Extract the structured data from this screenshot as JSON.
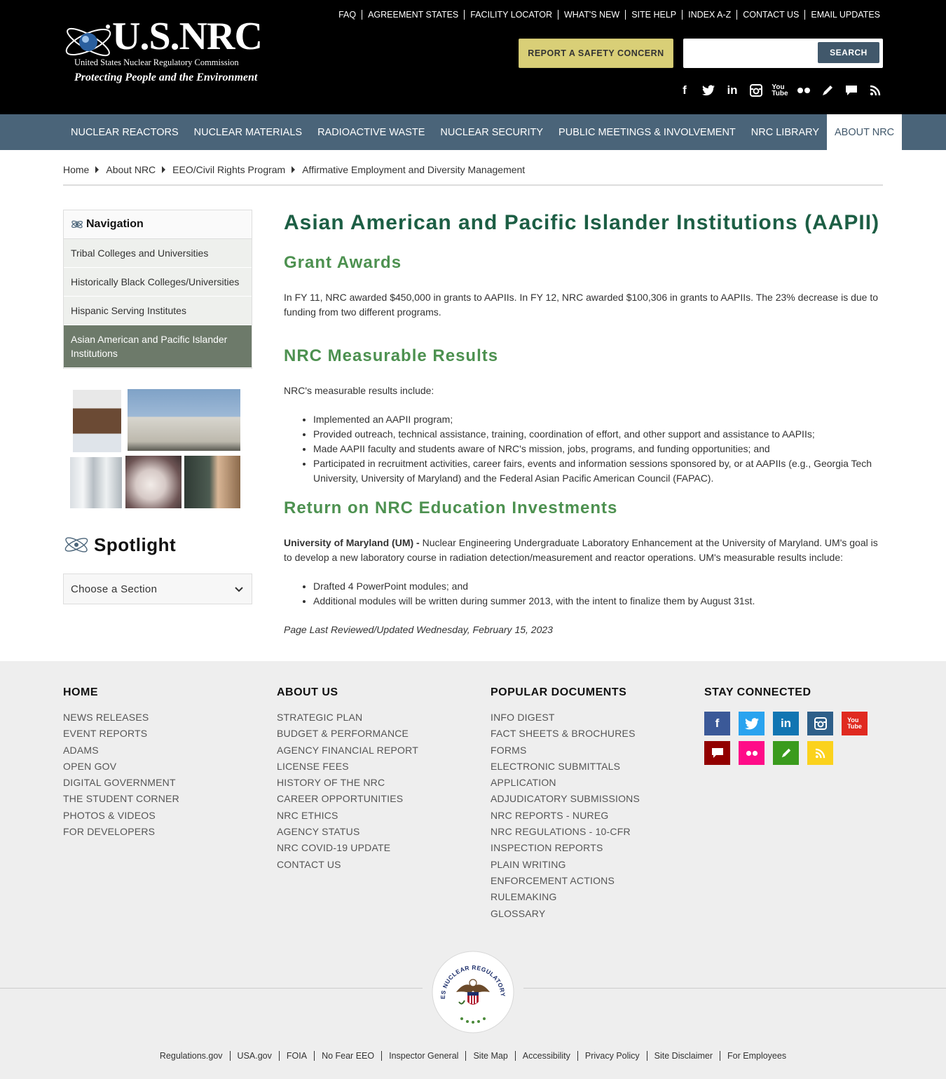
{
  "header": {
    "logo_main": "U.S.NRC",
    "logo_sub1": "United States Nuclear Regulatory Commission",
    "logo_sub2": "Protecting People and the Environment",
    "utility_links": [
      "FAQ",
      "AGREEMENT STATES",
      "FACILITY LOCATOR",
      "WHAT'S NEW",
      "SITE HELP",
      "INDEX A-Z",
      "CONTACT US",
      "EMAIL UPDATES"
    ],
    "report_button": "REPORT A SAFETY CONCERN",
    "search_button": "SEARCH",
    "search_placeholder": "",
    "social_icons": [
      "facebook-icon",
      "twitter-icon",
      "linkedin-icon",
      "instagram-icon",
      "youtube-icon",
      "flickr-icon",
      "blog-icon",
      "comment-icon",
      "rss-icon"
    ]
  },
  "mainnav": {
    "items": [
      "NUCLEAR REACTORS",
      "NUCLEAR MATERIALS",
      "RADIOACTIVE WASTE",
      "NUCLEAR SECURITY",
      "PUBLIC MEETINGS & INVOLVEMENT",
      "NRC LIBRARY",
      "ABOUT NRC"
    ],
    "active": "ABOUT NRC"
  },
  "breadcrumb": [
    "Home",
    "About NRC",
    "EEO/Civil Rights Program",
    "Affirmative Employment and Diversity Management"
  ],
  "sidebar": {
    "nav_title": "Navigation",
    "items": [
      "Tribal Colleges and Universities",
      "Historically Black Colleges/Universities",
      "Hispanic Serving Institutes",
      "Asian American and Pacific Islander Institutions"
    ],
    "active_index": 3,
    "spotlight_title": "Spotlight",
    "choose_section": "Choose a Section"
  },
  "content": {
    "title": "Asian American and Pacific Islander Institutions (AAPII)",
    "grant_heading": "Grant Awards",
    "grant_text": "In FY 11, NRC awarded $450,000 in grants to AAPIIs. In FY 12, NRC awarded $100,306 in grants to AAPIIs. The 23% decrease is due to funding from two different programs.",
    "results_heading": "NRC Measurable Results",
    "results_intro": "NRC's measurable results include:",
    "results_list": [
      "Implemented an AAPII program;",
      "Provided outreach, technical assistance, training, coordination of effort, and other support and assistance to AAPIIs;",
      "Made AAPII faculty and students aware of NRC's mission, jobs, programs, and funding opportunities; and",
      "Participated in recruitment activities, career fairs, events and information sessions sponsored by, or at AAPIIs (e.g., Georgia Tech University, University of Maryland) and the Federal Asian Pacific American Council (FAPAC)."
    ],
    "roi_heading": "Return on NRC Education Investments",
    "roi_bold": "University of Maryland (UM) - ",
    "roi_text": "Nuclear Engineering Undergraduate Laboratory Enhancement at the University of Maryland. UM's goal is to develop a new laboratory course in radiation detection/measurement and reactor operations. UM's measurable results include:",
    "roi_list": [
      "Drafted 4 PowerPoint modules; and",
      "Additional modules will be written during summer 2013, with the intent to finalize them by August 31st."
    ],
    "reviewed": "Page Last Reviewed/Updated Wednesday, February 15, 2023"
  },
  "footer": {
    "col1": {
      "title": "HOME",
      "links": [
        "NEWS RELEASES",
        "EVENT REPORTS",
        "ADAMS",
        "OPEN GOV",
        "DIGITAL GOVERNMENT",
        "THE STUDENT CORNER",
        "PHOTOS & VIDEOS",
        "FOR DEVELOPERS"
      ]
    },
    "col2": {
      "title": "ABOUT US",
      "links": [
        "STRATEGIC PLAN",
        "BUDGET & PERFORMANCE",
        "AGENCY FINANCIAL REPORT",
        "LICENSE FEES",
        "HISTORY OF THE NRC",
        "CAREER OPPORTUNITIES",
        "NRC ETHICS",
        "AGENCY STATUS",
        "NRC COVID-19 UPDATE",
        "CONTACT US"
      ]
    },
    "col3": {
      "title": "POPULAR DOCUMENTS",
      "links": [
        "INFO DIGEST",
        "FACT SHEETS & BROCHURES",
        "FORMS",
        "ELECTRONIC SUBMITTALS",
        "APPLICATION",
        "ADJUDICATORY SUBMISSIONS",
        "NRC REPORTS - NUREG",
        "NRC REGULATIONS - 10-CFR",
        "INSPECTION REPORTS",
        "PLAIN WRITING",
        "ENFORCEMENT ACTIONS",
        "RULEMAKING",
        "GLOSSARY"
      ]
    },
    "col4": {
      "title": "STAY CONNECTED"
    },
    "social_colors": {
      "facebook": "#3b5998",
      "twitter": "#2aa3ef",
      "linkedin": "#1175b2",
      "instagram": "#2e5f89",
      "youtube": "#e02a20",
      "comment": "#920000",
      "flickr": "#ff0c88",
      "blog": "#3a9b1d",
      "rss": "#fbd21d"
    },
    "seal_text": "UNITED STATES NUCLEAR REGULATORY COMMISSION",
    "bottom_links": [
      "Regulations.gov",
      "USA.gov",
      "FOIA",
      "No Fear EEO",
      "Inspector General",
      "Site Map",
      "Accessibility",
      "Privacy Policy",
      "Site Disclaimer",
      "For Employees"
    ]
  }
}
